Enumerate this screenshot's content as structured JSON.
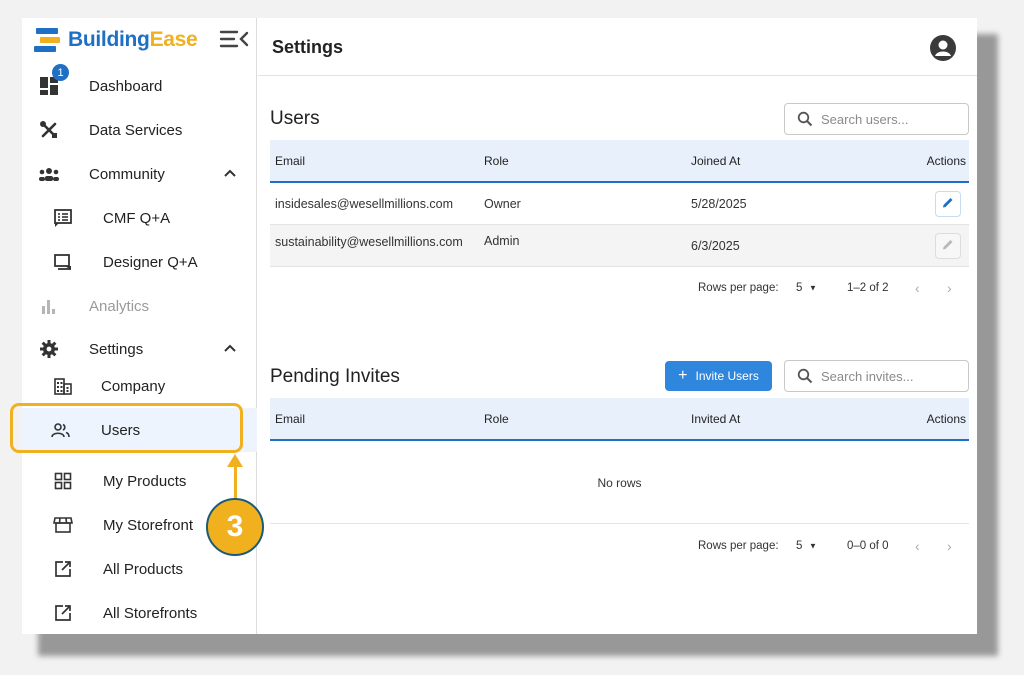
{
  "brand": {
    "name_part1": "Building",
    "name_part2": "Ease"
  },
  "colors": {
    "primary": "#1f6fc5",
    "accent": "#f1b11f",
    "header_bg": "#e8f1fb"
  },
  "sidebar": {
    "dashboard_badge": "1",
    "items": [
      {
        "label": "Dashboard",
        "icon": "dashboard-icon"
      },
      {
        "label": "Data Services",
        "icon": "tools-icon"
      },
      {
        "label": "Community",
        "icon": "people-icon",
        "expanded": true
      },
      {
        "label": "CMF Q+A",
        "icon": "forum-icon"
      },
      {
        "label": "Designer Q+A",
        "icon": "chat-icon"
      },
      {
        "label": "Analytics",
        "icon": "bar-chart-icon",
        "disabled": true
      },
      {
        "label": "Settings",
        "icon": "gear-icon",
        "expanded": true
      },
      {
        "label": "Company",
        "icon": "building-icon"
      },
      {
        "label": "Users",
        "icon": "users-icon",
        "active": true
      },
      {
        "label": "My Products",
        "icon": "grid-icon"
      },
      {
        "label": "My Storefront",
        "icon": "storefront-icon"
      },
      {
        "label": "All Products",
        "icon": "external-link-icon"
      },
      {
        "label": "All Storefronts",
        "icon": "external-link-icon"
      }
    ]
  },
  "callout": {
    "step": "3"
  },
  "header": {
    "title": "Settings"
  },
  "users_section": {
    "title": "Users",
    "search_placeholder": "Search users...",
    "columns": {
      "email": "Email",
      "role": "Role",
      "date": "Joined At",
      "actions": "Actions"
    },
    "rows": [
      {
        "email": "insidesales@wesellmillions.com",
        "role": "Owner",
        "date": "5/28/2025"
      },
      {
        "email": "sustainability@wesellmillions.com",
        "role": "Admin",
        "date": "6/3/2025"
      }
    ],
    "pagination": {
      "label": "Rows per page:",
      "size": "5",
      "range": "1–2 of 2"
    }
  },
  "invites_section": {
    "title": "Pending Invites",
    "invite_button": "Invite Users",
    "search_placeholder": "Search invites...",
    "columns": {
      "email": "Email",
      "role": "Role",
      "date": "Invited At",
      "actions": "Actions"
    },
    "empty_text": "No rows",
    "pagination": {
      "label": "Rows per page:",
      "size": "5",
      "range": "0–0 of 0"
    }
  }
}
